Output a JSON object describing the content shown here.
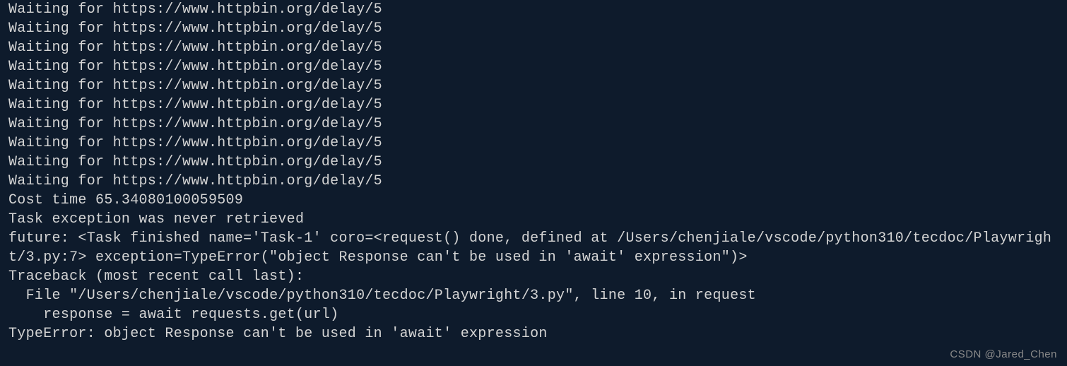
{
  "terminal": {
    "lines": [
      "Waiting for https://www.httpbin.org/delay/5",
      "Waiting for https://www.httpbin.org/delay/5",
      "Waiting for https://www.httpbin.org/delay/5",
      "Waiting for https://www.httpbin.org/delay/5",
      "Waiting for https://www.httpbin.org/delay/5",
      "Waiting for https://www.httpbin.org/delay/5",
      "Waiting for https://www.httpbin.org/delay/5",
      "Waiting for https://www.httpbin.org/delay/5",
      "Waiting for https://www.httpbin.org/delay/5",
      "Waiting for https://www.httpbin.org/delay/5",
      "Cost time 65.34080100059509",
      "Task exception was never retrieved",
      "future: <Task finished name='Task-1' coro=<request() done, defined at /Users/chenjiale/vscode/python310/tecdoc/Playwright/3.py:7> exception=TypeError(\"object Response can't be used in 'await' expression\")>",
      "Traceback (most recent call last):",
      "  File \"/Users/chenjiale/vscode/python310/tecdoc/Playwright/3.py\", line 10, in request",
      "    response = await requests.get(url)",
      "TypeError: object Response can't be used in 'await' expression"
    ]
  },
  "watermark": {
    "text": "CSDN @Jared_Chen"
  }
}
